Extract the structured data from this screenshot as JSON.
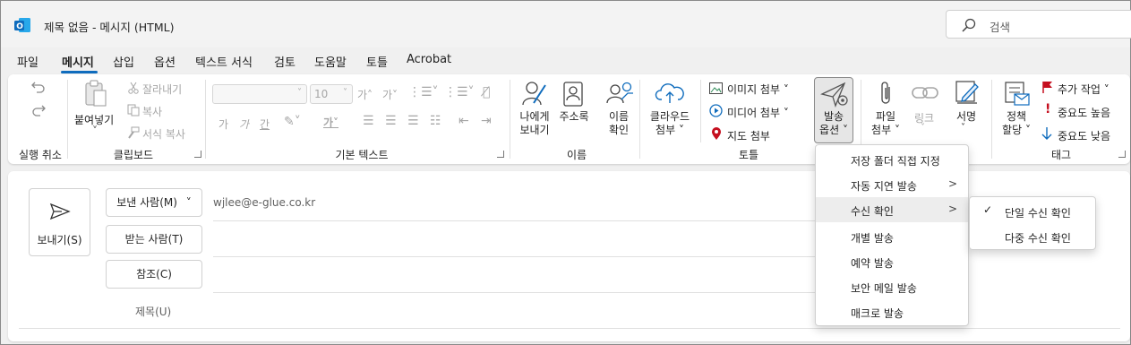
{
  "window": {
    "title": "제목 없음  -  메시지 (HTML)"
  },
  "search": {
    "placeholder": "검색"
  },
  "menu": [
    "파일",
    "메시지",
    "삽입",
    "옵션",
    "텍스트 서식",
    "검토",
    "도움말",
    "토틀",
    "Acrobat"
  ],
  "ribbon": {
    "groups": {
      "undo": "실행 취소",
      "clipboard": "클립보드",
      "basic_text": "기본 텍스트",
      "names": "이름",
      "tools": "토틀",
      "tags": "태그"
    },
    "clipboard": {
      "paste": "붙여넣기",
      "cut": "잘라내기",
      "copy": "복사",
      "format_painter": "서식 복사"
    },
    "font": {
      "size": "10"
    },
    "names": {
      "send_to_me_line1": "나에게",
      "send_to_me_line2": "보내기",
      "address_book": "주소록",
      "check_names_line1": "이름",
      "check_names_line2": "확인"
    },
    "tools": {
      "cloud_attach_line1": "클라우드",
      "cloud_attach_line2": "첨부 ˅",
      "image_attach": "이미지 첨부 ˅",
      "media_attach": "미디어 첨부 ˅",
      "map_attach": "지도 첨부",
      "send_options_line1": "발송",
      "send_options_line2": "옵션 ˅",
      "attach_file_line1": "파일",
      "attach_file_line2": "첨부 ˅",
      "link": "링크",
      "signature": "서명"
    },
    "tags": {
      "policy_line1": "정책",
      "policy_line2": "할당 ˅",
      "follow_up": "추가 작업 ˅",
      "high_importance": "중요도 높음",
      "low_importance": "중요도 낮음"
    }
  },
  "compose": {
    "send": "보내기(S)",
    "from_button": "보낸 사람(M)",
    "from_value": "wjlee@e-glue.co.kr",
    "to_button": "받는 사람(T)",
    "cc_button": "참조(C)",
    "subject_label": "제목(U)"
  },
  "send_options_menu": [
    "저장 폴더 직접 지정",
    "자동 지연 발송",
    "수신 확인",
    "개별 발송",
    "예약 발송",
    "보안 메일 발송",
    "매크로 발송"
  ],
  "receipt_submenu": [
    "단일 수신 확인",
    "다중 수신 확인"
  ],
  "colors": {
    "accent": "#0f6cbd",
    "red_flag": "#c50f1f"
  }
}
